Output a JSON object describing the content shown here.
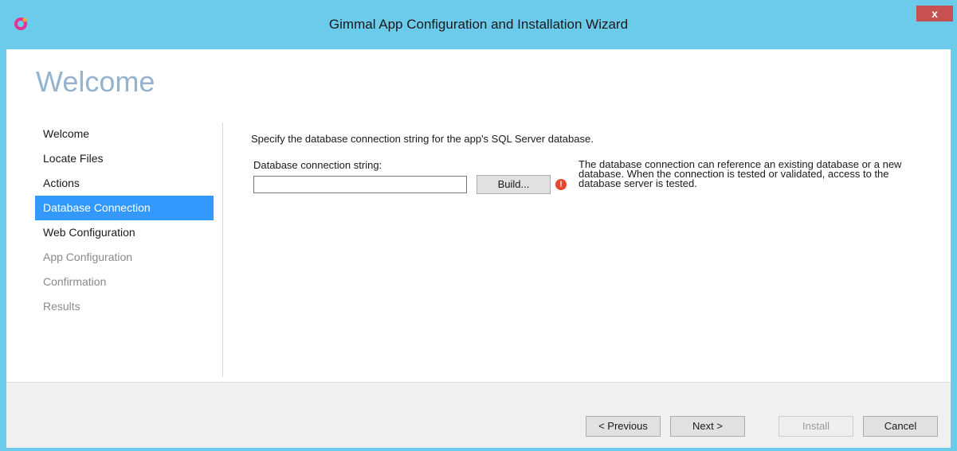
{
  "window": {
    "title": "Gimmal App Configuration and Installation Wizard",
    "close_label": "x"
  },
  "header": {
    "title": "Welcome"
  },
  "nav": {
    "items": [
      {
        "label": "Welcome",
        "state": "normal"
      },
      {
        "label": "Locate Files",
        "state": "normal"
      },
      {
        "label": "Actions",
        "state": "normal"
      },
      {
        "label": "Database Connection",
        "state": "selected"
      },
      {
        "label": "Web Configuration",
        "state": "normal"
      },
      {
        "label": "App Configuration",
        "state": "disabled"
      },
      {
        "label": "Confirmation",
        "state": "disabled"
      },
      {
        "label": "Results",
        "state": "disabled"
      }
    ]
  },
  "content": {
    "intro": "Specify the database connection string for the app's SQL Server database.",
    "connection_label": "Database connection string:",
    "connection_value": "",
    "build_label": "Build...",
    "help_lines": [
      "The database connection can reference an existing database or a new",
      "database.  When the connection is tested or validated, access to the",
      "database server is tested."
    ],
    "error_icon": "error-icon"
  },
  "footer": {
    "previous_label": "< Previous",
    "next_label": "Next >",
    "install_label": "Install",
    "cancel_label": "Cancel"
  },
  "colors": {
    "titlebar": "#6ccaea",
    "selected": "#3399ff",
    "header_title": "#95b3cf",
    "close": "#c75050",
    "error": "#e8472b"
  }
}
